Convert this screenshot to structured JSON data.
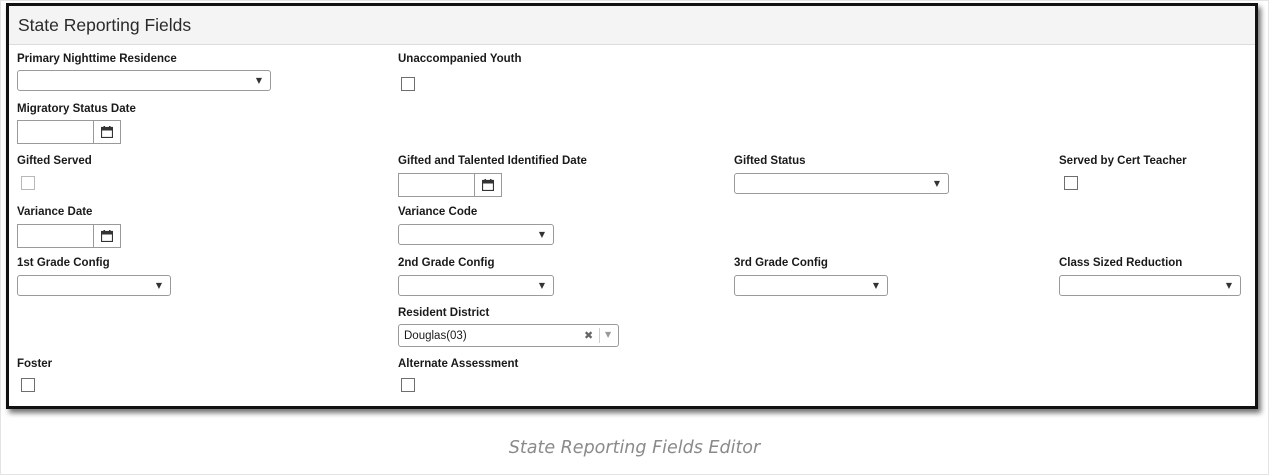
{
  "panel": {
    "title": "State Reporting Fields"
  },
  "fields": {
    "primary_nighttime_residence": {
      "label": "Primary Nighttime Residence",
      "value": ""
    },
    "unaccompanied_youth": {
      "label": "Unaccompanied Youth",
      "checked": false
    },
    "migratory_status_date": {
      "label": "Migratory Status Date",
      "value": ""
    },
    "gifted_served": {
      "label": "Gifted Served",
      "checked": false,
      "disabled": true
    },
    "gifted_talented_identified_date": {
      "label": "Gifted and Talented Identified Date",
      "value": ""
    },
    "gifted_status": {
      "label": "Gifted Status",
      "value": ""
    },
    "served_by_cert_teacher": {
      "label": "Served by Cert Teacher",
      "checked": false
    },
    "variance_date": {
      "label": "Variance Date",
      "value": ""
    },
    "variance_code": {
      "label": "Variance Code",
      "value": ""
    },
    "first_grade_config": {
      "label": "1st Grade Config",
      "value": ""
    },
    "second_grade_config": {
      "label": "2nd Grade Config",
      "value": ""
    },
    "third_grade_config": {
      "label": "3rd Grade Config",
      "value": ""
    },
    "class_sized_reduction": {
      "label": "Class Sized Reduction",
      "value": ""
    },
    "resident_district": {
      "label": "Resident District",
      "value": "Douglas(03)"
    },
    "foster": {
      "label": "Foster",
      "checked": false
    },
    "alternate_assessment": {
      "label": "Alternate Assessment",
      "checked": false
    }
  },
  "icons": {
    "dropdown": "chevron-down-icon",
    "calendar": "calendar-icon",
    "clear": "clear-x-icon"
  },
  "colors": {
    "panel_border": "#111111",
    "header_bg": "#f4f4f4",
    "caption": "#8a8a8a"
  },
  "caption": "State Reporting Fields Editor"
}
